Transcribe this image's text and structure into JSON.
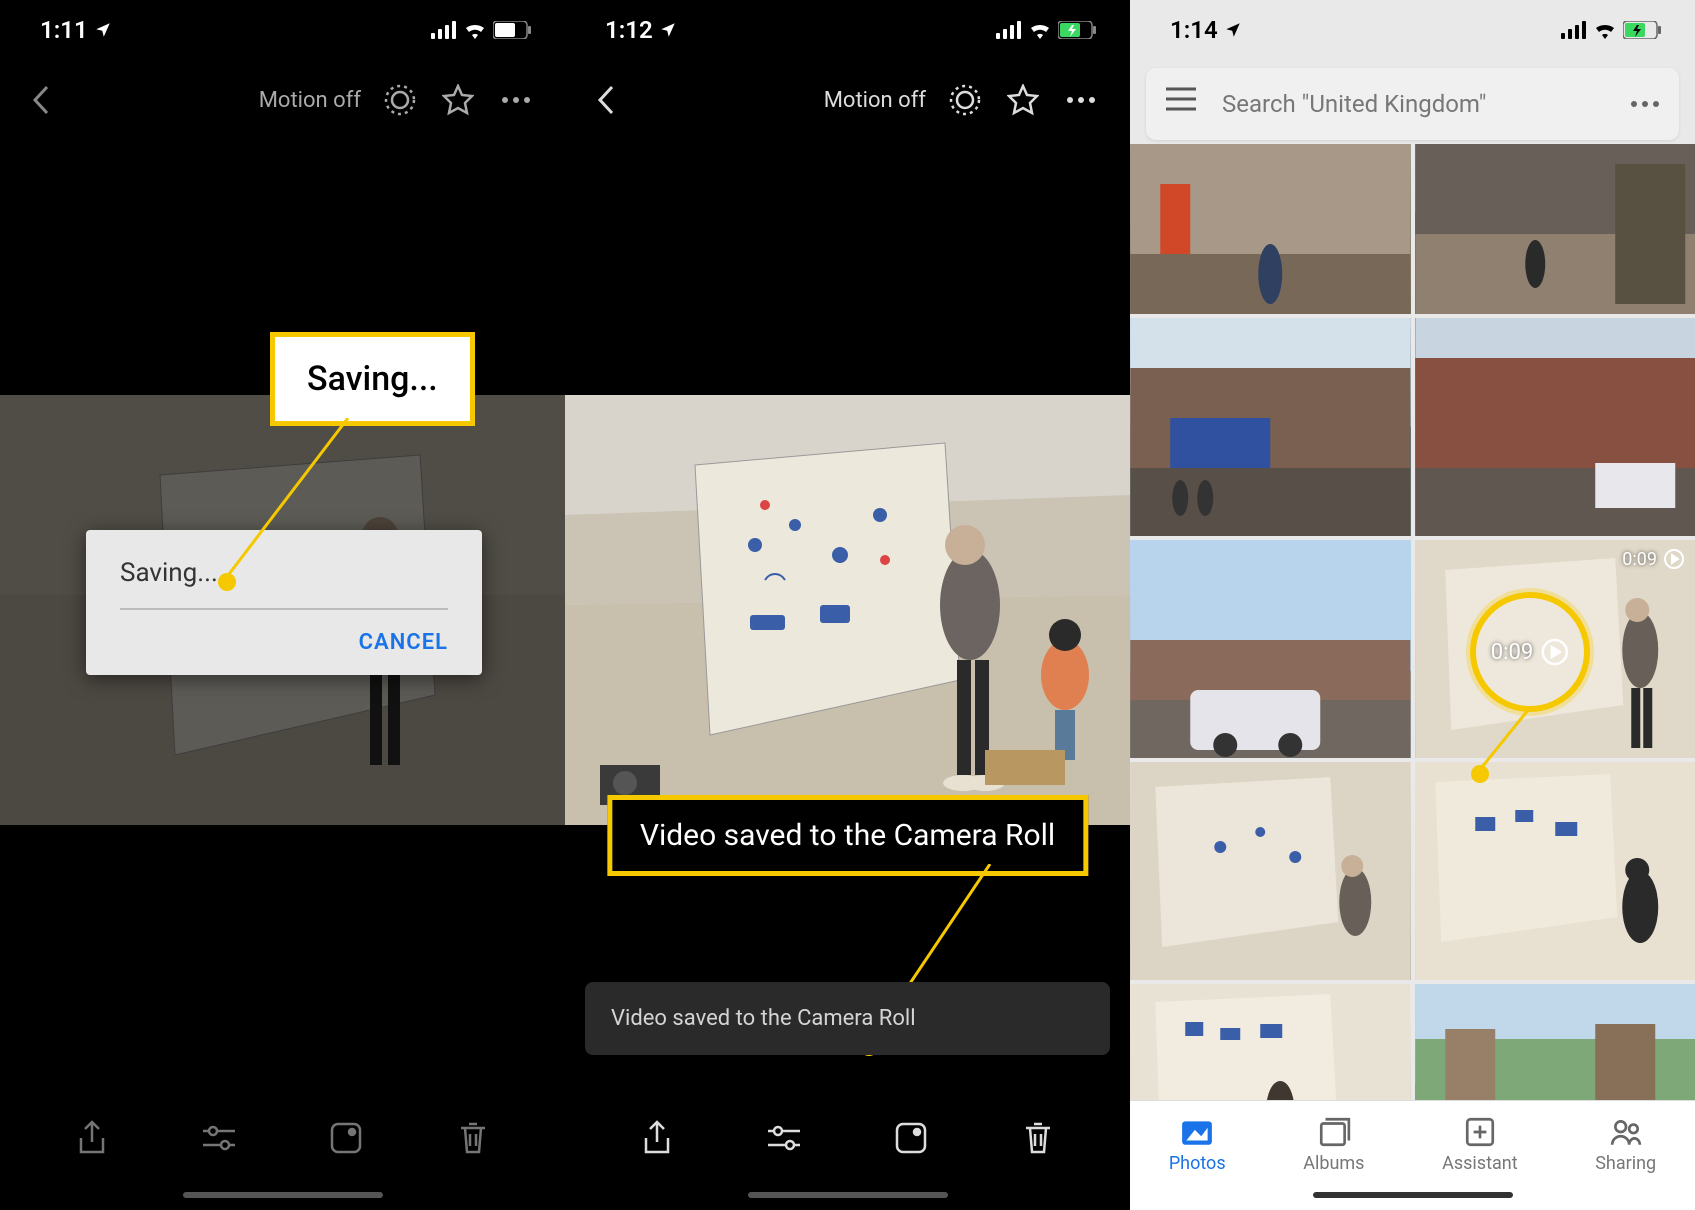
{
  "phone1": {
    "status_time": "1:11",
    "header_motion": "Motion off",
    "dialog_title": "Saving...",
    "dialog_cancel": "CANCEL",
    "callout_text": "Saving..."
  },
  "phone2": {
    "status_time": "1:12",
    "header_motion": "Motion off",
    "toast_text": "Video saved to the Camera Roll",
    "callout_text": "Video saved to the Camera Roll"
  },
  "phone3": {
    "status_time": "1:14",
    "search_placeholder": "Search \"United Kingdom\"",
    "video_duration": "0:09",
    "callout_duration": "0:09",
    "tabs": {
      "photos": "Photos",
      "albums": "Albums",
      "assistant": "Assistant",
      "sharing": "Sharing"
    }
  }
}
